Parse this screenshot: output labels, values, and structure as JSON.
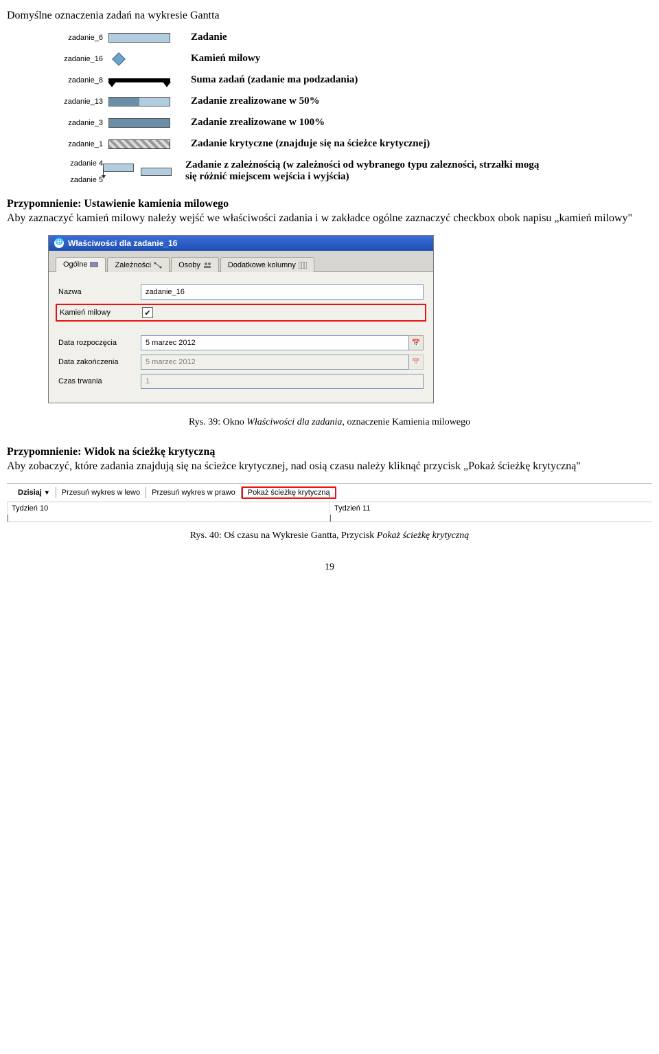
{
  "heading": "Domyślne oznaczenia zadań na wykresie Gantta",
  "legend": [
    {
      "label": "zadanie_6",
      "desc": "Zadanie"
    },
    {
      "label": "zadanie_16",
      "desc": "Kamień milowy"
    },
    {
      "label": "zadanie_8",
      "desc": "Suma zadań (zadanie ma podzadania)"
    },
    {
      "label": "zadanie_13",
      "desc": "Zadanie zrealizowane w 50%"
    },
    {
      "label": "zadanie_3",
      "desc": "Zadanie zrealizowane w 100%"
    },
    {
      "label": "zadanie_1",
      "desc": "Zadanie krytyczne (znajduje się na ścieżce krytycznej)"
    },
    {
      "label_a": "zadanie 4",
      "label_b": "zadanie 5",
      "desc": "Zadanie z zależnością (w zależności od wybranego typu zalezności, strzałki mogą się różnić miejscem wejścia i wyjścia)"
    }
  ],
  "reminder1_title": "Przypomnienie: Ustawienie kamienia milowego",
  "reminder1_text": "Aby zaznaczyć kamień milowy należy wejść we właściwości zadania i w zakładce ogólne zaznaczyć checkbox obok napisu „kamień milowy\"",
  "dialog": {
    "title": "Właściwości dla zadanie_16",
    "tabs": {
      "t1": "Ogólne",
      "t2": "Zależności",
      "t3": "Osoby",
      "t4": "Dodatkowe kolumny"
    },
    "rows": {
      "name_label": "Nazwa",
      "name_value": "zadanie_16",
      "milestone_label": "Kamień milowy",
      "start_label": "Data rozpoczęcia",
      "start_value": "5 marzec 2012",
      "end_label": "Data zakończenia",
      "end_value": "5 marzec 2012",
      "duration_label": "Czas trwania",
      "duration_value": "1"
    }
  },
  "caption1_prefix": "Rys. 39: Okno ",
  "caption1_italic": "Właściwości dla zadania",
  "caption1_suffix": ", oznaczenie Kamienia milowego",
  "reminder2_title": "Przypomnienie: Widok na ścieżkę krytyczną",
  "reminder2_text": "Aby zobaczyć, które zadania znajdują się na ścieżce krytycznej, nad osią czasu należy kliknąć przycisk „Pokaż ścieżkę krytyczną\"",
  "toolbar": {
    "today": "Dzisiaj",
    "left": "Przesuń wykres w lewo",
    "right": "Przesuń wykres w prawo",
    "critical": "Pokaż ścieżkę krytyczną"
  },
  "timeline": {
    "week10": "Tydzień 10",
    "week11": "Tydzień 11"
  },
  "caption2_prefix": "Rys. 40: Oś czasu na Wykresie Gantta, Przycisk ",
  "caption2_italic": "Pokaż ścieżkę krytyczną",
  "page_number": "19"
}
